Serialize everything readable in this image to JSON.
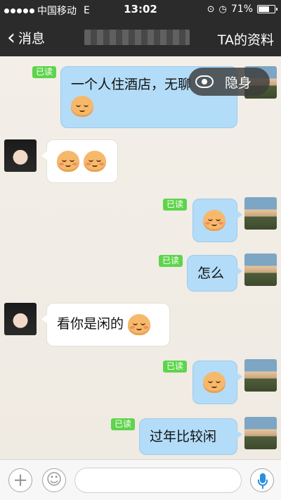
{
  "status_bar": {
    "carrier": "中国移动",
    "network": "E",
    "time": "13:02",
    "battery_percent": "71%",
    "battery_level": 0.71
  },
  "nav": {
    "back_label": "消息",
    "profile_label": "TA的资料"
  },
  "overlay": {
    "hide_label": "隐身"
  },
  "messages": [
    {
      "side": "sent",
      "text": "一个人住酒店，无聊",
      "emoji": "shy-face-emoji",
      "read": "已读"
    },
    {
      "side": "received",
      "text": "",
      "emoji": "shy-face-emoji"
    },
    {
      "side": "sent",
      "text": "",
      "emoji": "covering-mouth-emoji",
      "read": "已读"
    },
    {
      "side": "sent",
      "text": "怎么",
      "read": "已读"
    },
    {
      "side": "received",
      "text": "看你是闲的",
      "emoji": "shy-face-emoji"
    },
    {
      "side": "sent",
      "text": "",
      "emoji": "sweat-face-emoji",
      "read": "已读"
    },
    {
      "side": "sent",
      "text": "过年比较闲",
      "read": "已读"
    }
  ],
  "colors": {
    "sent_bubble": "#b3dcf8",
    "received_bubble": "#ffffff",
    "read_badge": "#5ed44c",
    "header": "#2b2b2b",
    "mic": "#2b8fde"
  }
}
